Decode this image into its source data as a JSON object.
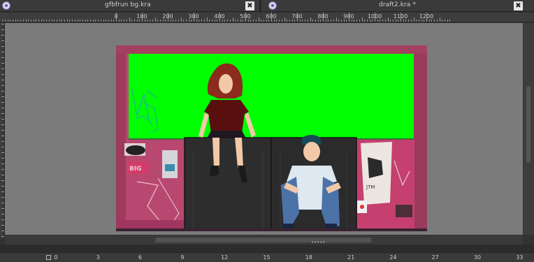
{
  "tabs": {
    "left_title": "gfbfrun bg.kra",
    "right_title": "draft2.kra *",
    "close_glyph": "✖"
  },
  "ruler_top": {
    "labels": [
      "0",
      "100",
      "200",
      "300",
      "400",
      "500",
      "600",
      "700",
      "800",
      "900",
      "1000",
      "1100",
      "1200"
    ]
  },
  "ruler_bottom": {
    "labels": [
      "0",
      "3",
      "6",
      "9",
      "12",
      "15",
      "18",
      "21",
      "24",
      "27",
      "30",
      "33"
    ]
  },
  "scrollbar": {
    "grip": "•••••"
  },
  "colors": {
    "canvas_bg": "#7b7b7b",
    "green_screen": "#00ff00",
    "wall_pink": "#b8486f",
    "bench_dark": "#2c2c2c"
  },
  "icons": [
    "krita-app-icon",
    "close-icon",
    "frame-icon"
  ]
}
